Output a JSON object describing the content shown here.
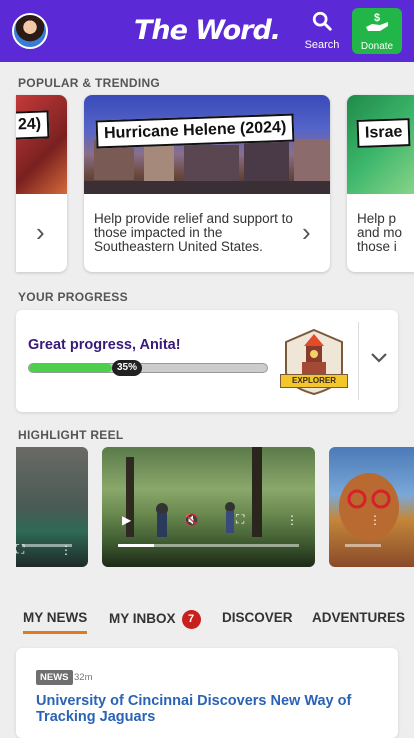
{
  "header": {
    "logo": "The Word.",
    "search_label": "Search",
    "donate_label": "Donate"
  },
  "trending": {
    "section_title": "POPULAR & TRENDING",
    "cards": [
      {
        "banner": "24)",
        "desc": ""
      },
      {
        "banner": "Hurricane Helene (2024)",
        "desc": "Help provide relief and support to those impacted in the Southeastern United States."
      },
      {
        "banner": "Israe",
        "desc": "Help p and mo those i"
      }
    ]
  },
  "progress": {
    "section_title": "YOUR PROGRESS",
    "message": "Great progress, Anita!",
    "percent_label": "35%",
    "percent_value": 0.35,
    "badge_label": "EXPLORER"
  },
  "highlight": {
    "section_title": "HIGHLIGHT REEL"
  },
  "tabs": [
    {
      "label": "MY NEWS"
    },
    {
      "label": "MY INBOX",
      "count": "7"
    },
    {
      "label": "DISCOVER"
    },
    {
      "label": "ADVENTURES"
    }
  ],
  "news": {
    "tag": "NEWS",
    "time": "32m",
    "headline": "University of Cincinnai Discovers New Way of Tracking Jaguars"
  },
  "colors": {
    "brand": "#5b2ad6",
    "donate": "#22b548",
    "accent_tab": "#e07a1f",
    "link": "#2a63b5"
  }
}
